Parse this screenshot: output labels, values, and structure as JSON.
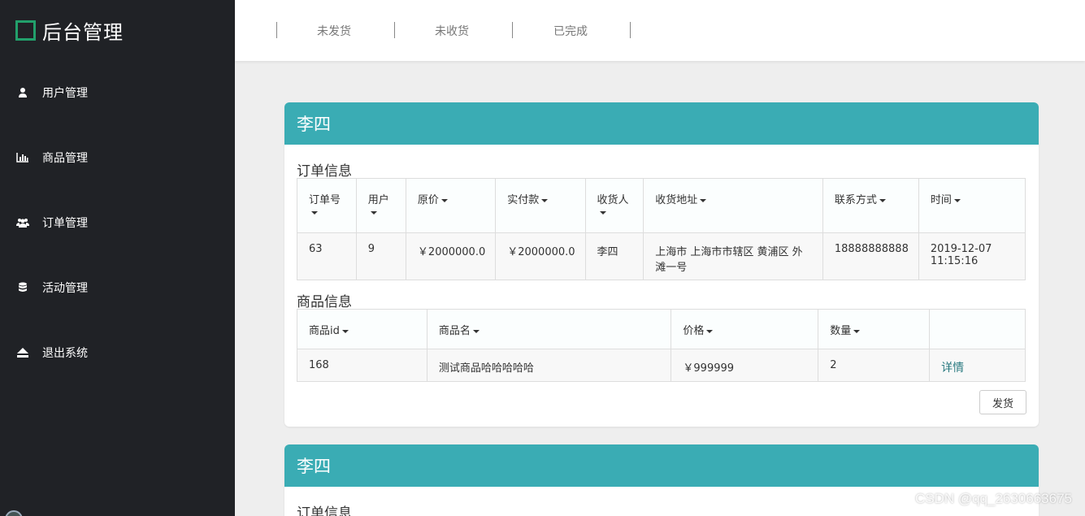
{
  "app": {
    "title": "后台管理"
  },
  "sidebar": {
    "items": [
      {
        "label": "用户管理",
        "icon": "user-icon"
      },
      {
        "label": "商品管理",
        "icon": "bar-chart-icon"
      },
      {
        "label": "订单管理",
        "icon": "users-icon"
      },
      {
        "label": "活动管理",
        "icon": "database-icon"
      },
      {
        "label": "退出系统",
        "icon": "eject-icon"
      }
    ]
  },
  "topbar": {
    "tabs": [
      "未发货",
      "未收货",
      "已完成"
    ]
  },
  "orders": [
    {
      "customer": "李四",
      "order_section": "订单信息",
      "order_headers": [
        "订单号",
        "用户",
        "原价",
        "实付款",
        "收货人",
        "收货地址",
        "联系方式",
        "时间"
      ],
      "order_row": {
        "id": "63",
        "user": "9",
        "original_price": "￥2000000.0",
        "paid": "￥2000000.0",
        "receiver": "李四",
        "address": "上海市 上海市市辖区 黄浦区 外滩一号",
        "phone": "18888888888",
        "time": "2019-12-07 11:15:16"
      },
      "goods_section": "商品信息",
      "goods_headers": [
        "商品id",
        "商品名",
        "价格",
        "数量",
        ""
      ],
      "goods_row": {
        "id": "168",
        "name": "测试商品哈哈哈哈哈",
        "price": "￥999999",
        "quantity": "2",
        "detail_link": "详情"
      },
      "ship_button": "发货"
    },
    {
      "customer": "李四",
      "order_section": "订单信息"
    }
  ],
  "watermark": "CSDN @qq_2630663675",
  "colors": {
    "sidebar_bg": "#202226",
    "card_header": "#3aacb4",
    "brand_accent": "#22a06b",
    "page_bg": "#eeeeee"
  }
}
